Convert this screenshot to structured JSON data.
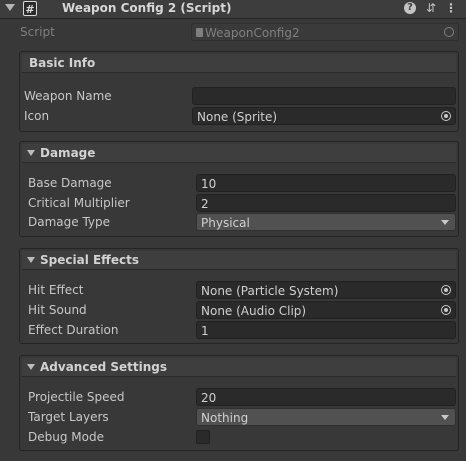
{
  "header": {
    "title": "Weapon Config 2 (Script)",
    "script_icon_glyph": "#",
    "help_glyph": "?",
    "preset_glyph": "⇵",
    "menu_glyph": "⋮"
  },
  "script_field": {
    "label": "Script",
    "value": "WeaponConfig2"
  },
  "sections": {
    "basic": {
      "title": "Basic Info",
      "weapon_name_label": "Weapon Name",
      "weapon_name_value": "",
      "icon_label": "Icon",
      "icon_value": "None (Sprite)"
    },
    "damage": {
      "title": "Damage",
      "base_damage_label": "Base Damage",
      "base_damage_value": "10",
      "critical_label": "Critical Multiplier",
      "critical_value": "2",
      "type_label": "Damage Type",
      "type_value": "Physical"
    },
    "effects": {
      "title": "Special Effects",
      "hit_effect_label": "Hit Effect",
      "hit_effect_value": "None (Particle System)",
      "hit_sound_label": "Hit Sound",
      "hit_sound_value": "None (Audio Clip)",
      "duration_label": "Effect Duration",
      "duration_value": "1"
    },
    "advanced": {
      "title": "Advanced Settings",
      "speed_label": "Projectile Speed",
      "speed_value": "20",
      "layers_label": "Target Layers",
      "layers_value": "Nothing",
      "debug_label": "Debug Mode",
      "debug_checked": false
    }
  },
  "icons": [
    "fold-arrow-icon",
    "script-icon",
    "help-icon",
    "preset-icon",
    "kebab-menu-icon",
    "object-picker-icon",
    "dropdown-arrow-icon"
  ]
}
